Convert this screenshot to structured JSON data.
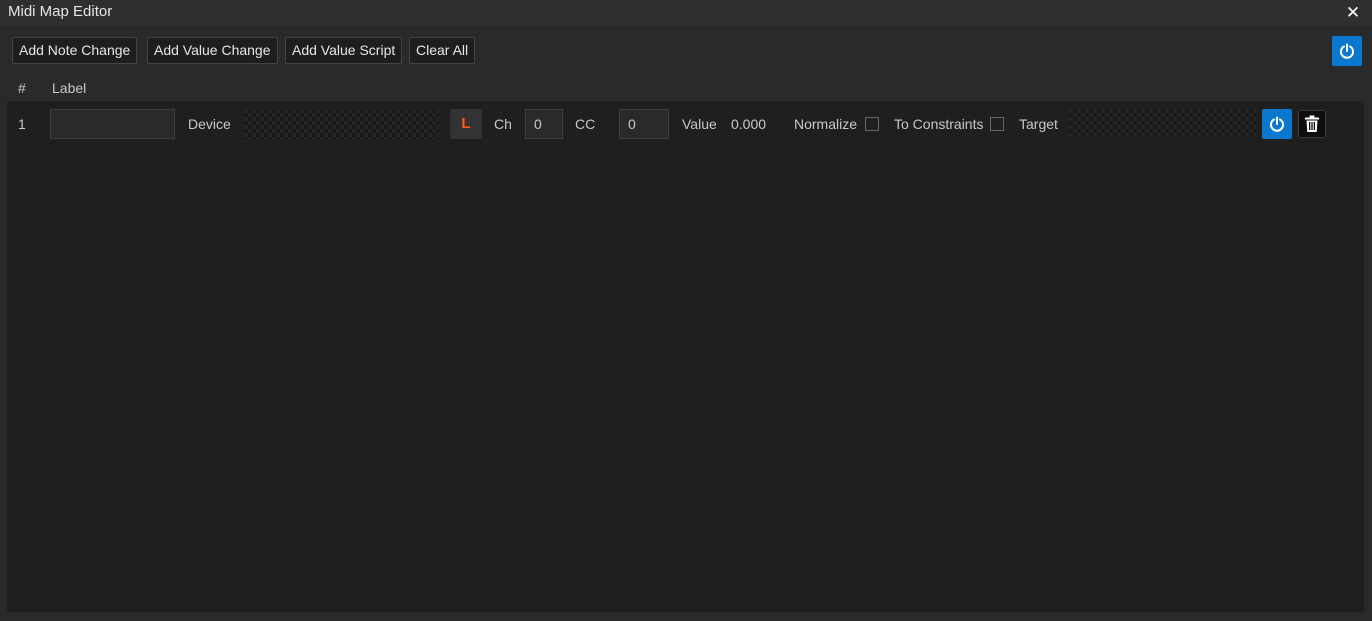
{
  "window": {
    "title": "Midi Map Editor",
    "close_glyph": "✕"
  },
  "toolbar": {
    "add_note_change": "Add Note Change",
    "add_value_change": "Add Value Change",
    "add_value_script": "Add Value Script",
    "clear_all": "Clear All",
    "power_icon": "power-icon"
  },
  "columns": {
    "index": "#",
    "label": "Label"
  },
  "rows": [
    {
      "index": "1",
      "label_value": "",
      "device_label": "Device",
      "learn_label": "L",
      "channel_label": "Ch",
      "channel_value": "0",
      "cc_label": "CC",
      "cc_value": "0",
      "value_label": "Value",
      "value": "0.000",
      "normalize_label": "Normalize",
      "normalize_checked": false,
      "to_constraints_label": "To Constraints",
      "to_constraints_checked": false,
      "target_label": "Target"
    }
  ],
  "colors": {
    "accent": "#0b78d0",
    "learn": "#ff5a1f",
    "panel": "#1f1f1f",
    "background": "#2a2a2a"
  }
}
